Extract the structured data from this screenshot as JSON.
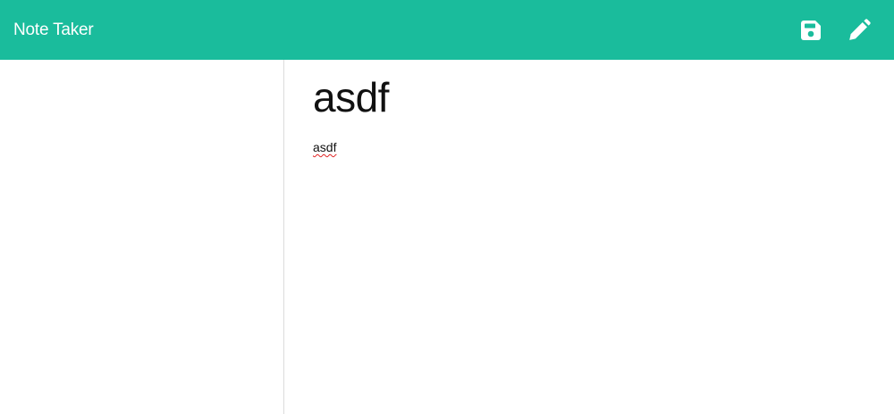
{
  "app": {
    "brand": "Note Taker"
  },
  "toolbar": {
    "save_icon": "save-icon",
    "edit_icon": "pencil-icon"
  },
  "note": {
    "title": "asdf",
    "body": "asdf"
  },
  "colors": {
    "navbar": "#1abc9c",
    "icon": "#ffffff",
    "spellcheck": "#e02424"
  }
}
